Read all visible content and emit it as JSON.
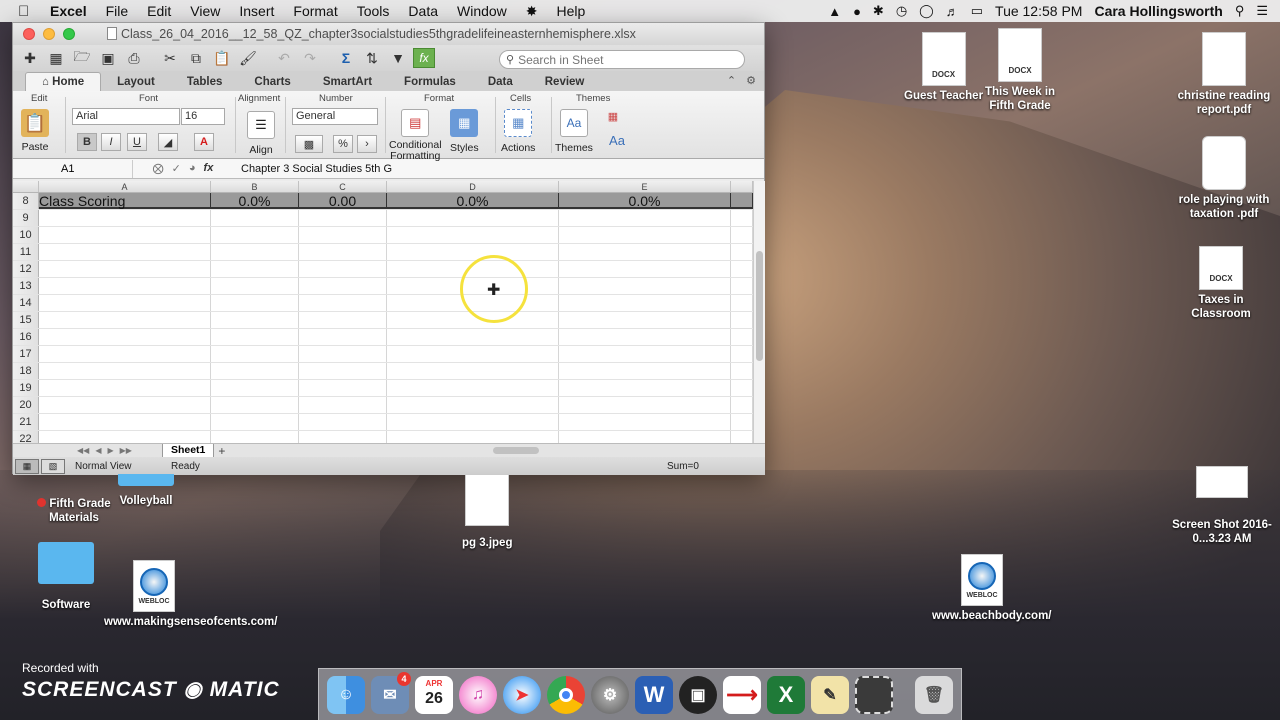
{
  "menubar": {
    "app": "Excel",
    "items": [
      "File",
      "Edit",
      "View",
      "Insert",
      "Format",
      "Tools",
      "Data",
      "Window",
      "Help"
    ],
    "battery": "",
    "clock": "Tue 12:58 PM",
    "user": "Cara Hollingsworth"
  },
  "window": {
    "title": "Class_26_04_2016__12_58_QZ_chapter3socialstudies5thgradelifeineasternhemisphere.xlsx"
  },
  "search": {
    "placeholder": "Search in Sheet"
  },
  "ribbon_tabs": [
    "Home",
    "Layout",
    "Tables",
    "Charts",
    "SmartArt",
    "Formulas",
    "Data",
    "Review"
  ],
  "ribbon": {
    "groups": {
      "edit": "Edit",
      "font": "Font",
      "alignment": "Alignment",
      "number": "Number",
      "format": "Format",
      "cells": "Cells",
      "themes": "Themes"
    },
    "paste": "Paste",
    "font_name": "Arial",
    "font_size": "16",
    "bold": "B",
    "italic": "I",
    "underline": "U",
    "align": "Align",
    "number_format": "General",
    "percent": "%",
    "comma": "›",
    "conditional_formatting_1": "Conditional",
    "conditional_formatting_2": "Formatting",
    "styles": "Styles",
    "actions": "Actions",
    "themes": "Themes",
    "aa": "Aa"
  },
  "formula_bar": {
    "cell": "A1",
    "fx": "fx",
    "value": "Chapter 3 Social Studies 5th G"
  },
  "columns": [
    "A",
    "B",
    "C",
    "D",
    "E"
  ],
  "rows": [
    {
      "num": "8",
      "cells": [
        "Class Scoring",
        "0.0%",
        "0.00",
        "0.0%",
        "0.0%"
      ]
    },
    {
      "num": "9"
    },
    {
      "num": "10"
    },
    {
      "num": "11"
    },
    {
      "num": "12"
    },
    {
      "num": "13"
    },
    {
      "num": "14"
    },
    {
      "num": "15"
    },
    {
      "num": "16"
    },
    {
      "num": "17"
    },
    {
      "num": "18"
    },
    {
      "num": "19"
    },
    {
      "num": "20"
    },
    {
      "num": "21"
    },
    {
      "num": "22"
    }
  ],
  "sheet_tab": "Sheet1",
  "status": {
    "view": "Normal View",
    "ready": "Ready",
    "sum": "Sum=0"
  },
  "desktop": [
    {
      "label": "Guest Teacher",
      "badge": "DOCX"
    },
    {
      "label": "This Week in Fifth Grade",
      "badge": "DOCX"
    },
    {
      "label": "christine reading report.pdf"
    },
    {
      "label": "role playing with taxation .pdf"
    },
    {
      "label": "Taxes in Classroom",
      "badge": "DOCX"
    },
    {
      "label": "Screen Shot 2016-0...3.23 AM"
    },
    {
      "label": "Fifth Grade Materials"
    },
    {
      "label": "Volleyball"
    },
    {
      "label": "pg 3.jpeg"
    },
    {
      "label": "Software"
    },
    {
      "label": "www.makingsenseofcents.com/",
      "badge": "WEBLOC"
    },
    {
      "label": "www.beachbody.com/",
      "badge": "WEBLOC"
    }
  ],
  "watermark": {
    "line1": "Recorded with",
    "brand": "SCREENCAST ◉ MATIC"
  },
  "dock": {
    "calendar_month": "APR",
    "calendar_day": "26",
    "mail_badge": "4"
  }
}
